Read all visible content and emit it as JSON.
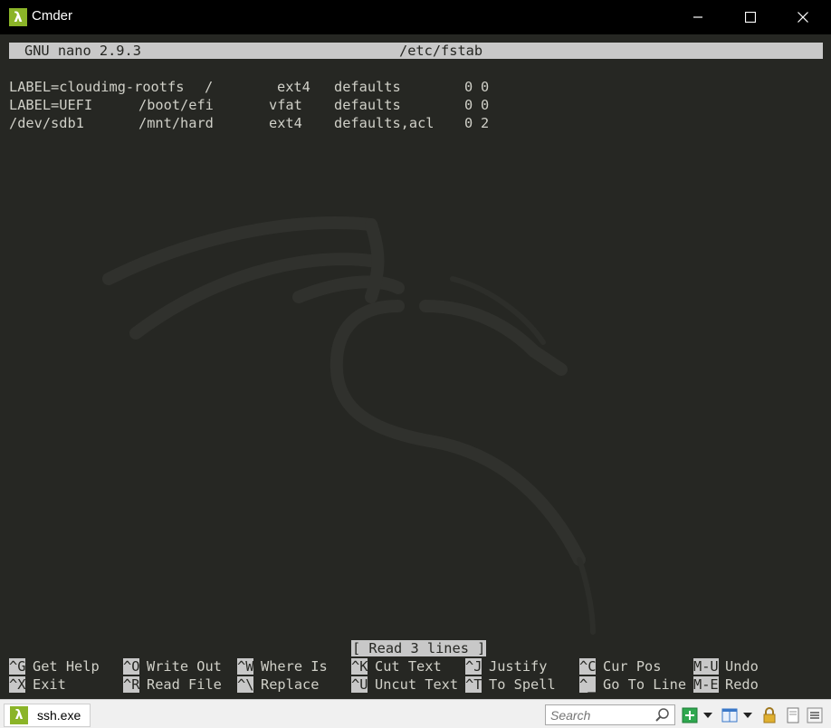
{
  "window": {
    "title": "Cmder",
    "icon": "lambda-icon",
    "icon_glyph": "λ",
    "accent": "#8bb428"
  },
  "nano": {
    "version": "GNU nano 2.9.3",
    "filename": "/etc/fstab",
    "status_message": "[ Read 3 lines ]"
  },
  "fstab_rows": [
    {
      "device": "LABEL=cloudimg-rootfs",
      "mount": "/",
      "type": "ext4",
      "options": "defaults",
      "dump": "0",
      "pass": "0"
    },
    {
      "device": "LABEL=UEFI",
      "mount": "/boot/efi",
      "type": "vfat",
      "options": "defaults",
      "dump": "0",
      "pass": "0"
    },
    {
      "device": "/dev/sdb1",
      "mount": "/mnt/hard",
      "type": "ext4",
      "options": "defaults,acl",
      "dump": "0",
      "pass": "2"
    }
  ],
  "shortcuts": {
    "row1": [
      {
        "key": "^G",
        "label": "Get Help"
      },
      {
        "key": "^O",
        "label": "Write Out"
      },
      {
        "key": "^W",
        "label": "Where Is"
      },
      {
        "key": "^K",
        "label": "Cut Text"
      },
      {
        "key": "^J",
        "label": "Justify"
      },
      {
        "key": "^C",
        "label": "Cur Pos"
      },
      {
        "key": "M-U",
        "label": "Undo"
      }
    ],
    "row2": [
      {
        "key": "^X",
        "label": "Exit"
      },
      {
        "key": "^R",
        "label": "Read File"
      },
      {
        "key": "^\\",
        "label": "Replace"
      },
      {
        "key": "^U",
        "label": "Uncut Text"
      },
      {
        "key": "^T",
        "label": "To Spell"
      },
      {
        "key": "^_",
        "label": "Go To Line"
      },
      {
        "key": "M-E",
        "label": "Redo"
      }
    ]
  },
  "statusbar": {
    "tab_label": "ssh.exe",
    "search_placeholder": "Search",
    "icons": [
      "search-icon",
      "new-console-icon",
      "dropdown-icon",
      "split-view-icon",
      "dropdown-icon",
      "lock-icon",
      "settings-menu-icon"
    ]
  },
  "colors": {
    "terminal_bg": "#262723",
    "terminal_fg": "#d0d0c8",
    "highlight_bg": "#c8c8c8"
  }
}
